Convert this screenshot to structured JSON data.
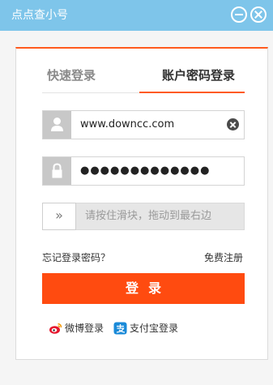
{
  "window": {
    "title": "点点查小号",
    "min_icon": "minimize-icon",
    "close_icon": "close-icon"
  },
  "tabs": [
    {
      "label": "快速登录",
      "active": false
    },
    {
      "label": "账户密码登录",
      "active": true
    }
  ],
  "form": {
    "username": "www.downcc.com",
    "password_mask": "●●●●●●●●●●●●●",
    "slider_hint": "请按住滑块，拖动到最右边",
    "slider_arrow": "»"
  },
  "links": {
    "forgot": "忘记登录密码？",
    "register": "免费注册"
  },
  "login_button": "登录",
  "third_party": [
    {
      "label": "微博登录",
      "icon": "weibo-icon"
    },
    {
      "label": "支付宝登录",
      "icon": "alipay-icon"
    }
  ],
  "colors": {
    "titlebar": "#7ec5ea",
    "accent": "#ff4b10",
    "alipay_blue": "#1a8ad8",
    "weibo_red": "#e6162d"
  }
}
